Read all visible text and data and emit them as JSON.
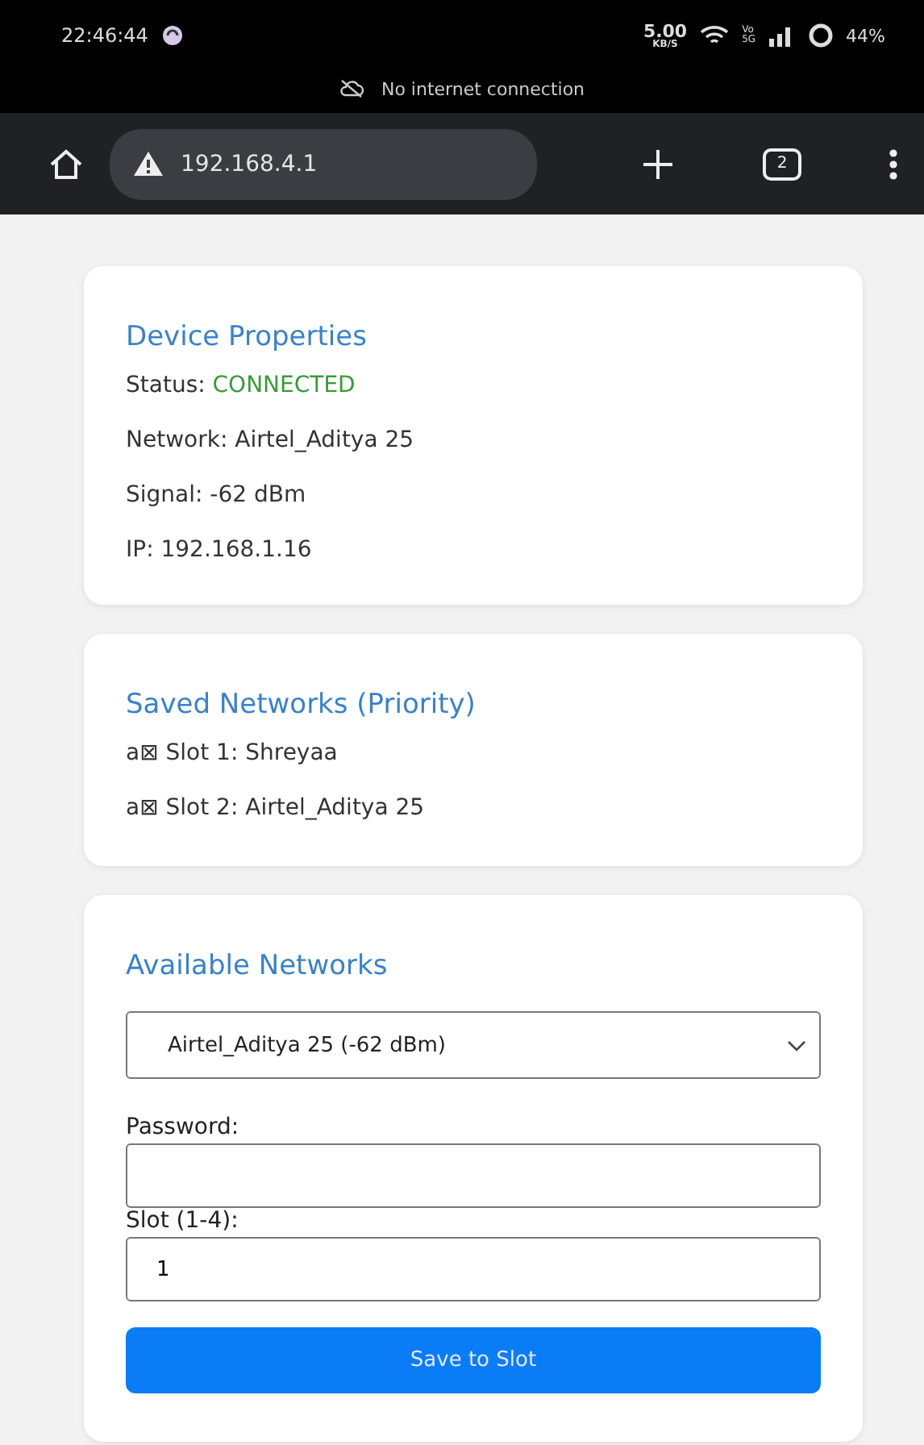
{
  "status_bar": {
    "time": "22:46:44",
    "speed": "5.00",
    "speed_unit": "KB/S",
    "volte": "Vo",
    "network_type": "5G",
    "battery": "44%"
  },
  "connectivity_notice": "No internet connection",
  "browser": {
    "url": "192.168.4.1",
    "tab_count": "2"
  },
  "device_properties": {
    "title": "Device Properties",
    "status_label": "Status:",
    "status_value": "CONNECTED",
    "connected": true,
    "lines": [
      "Network: Airtel_Aditya 25",
      "Signal: -62 dBm",
      "IP: 192.168.1.16"
    ]
  },
  "saved_networks": {
    "title": "Saved Networks (Priority)",
    "items": [
      "a⊠ Slot 1: Shreyaa",
      "a⊠ Slot 2: Airtel_Aditya 25"
    ]
  },
  "available_networks": {
    "title": "Available Networks",
    "selected_network": "Airtel_Aditya 25 (-62 dBm)",
    "password_label": "Password:",
    "slot_label": "Slot (1-4):",
    "slot_value": "1",
    "save_button": "Save to Slot"
  }
}
